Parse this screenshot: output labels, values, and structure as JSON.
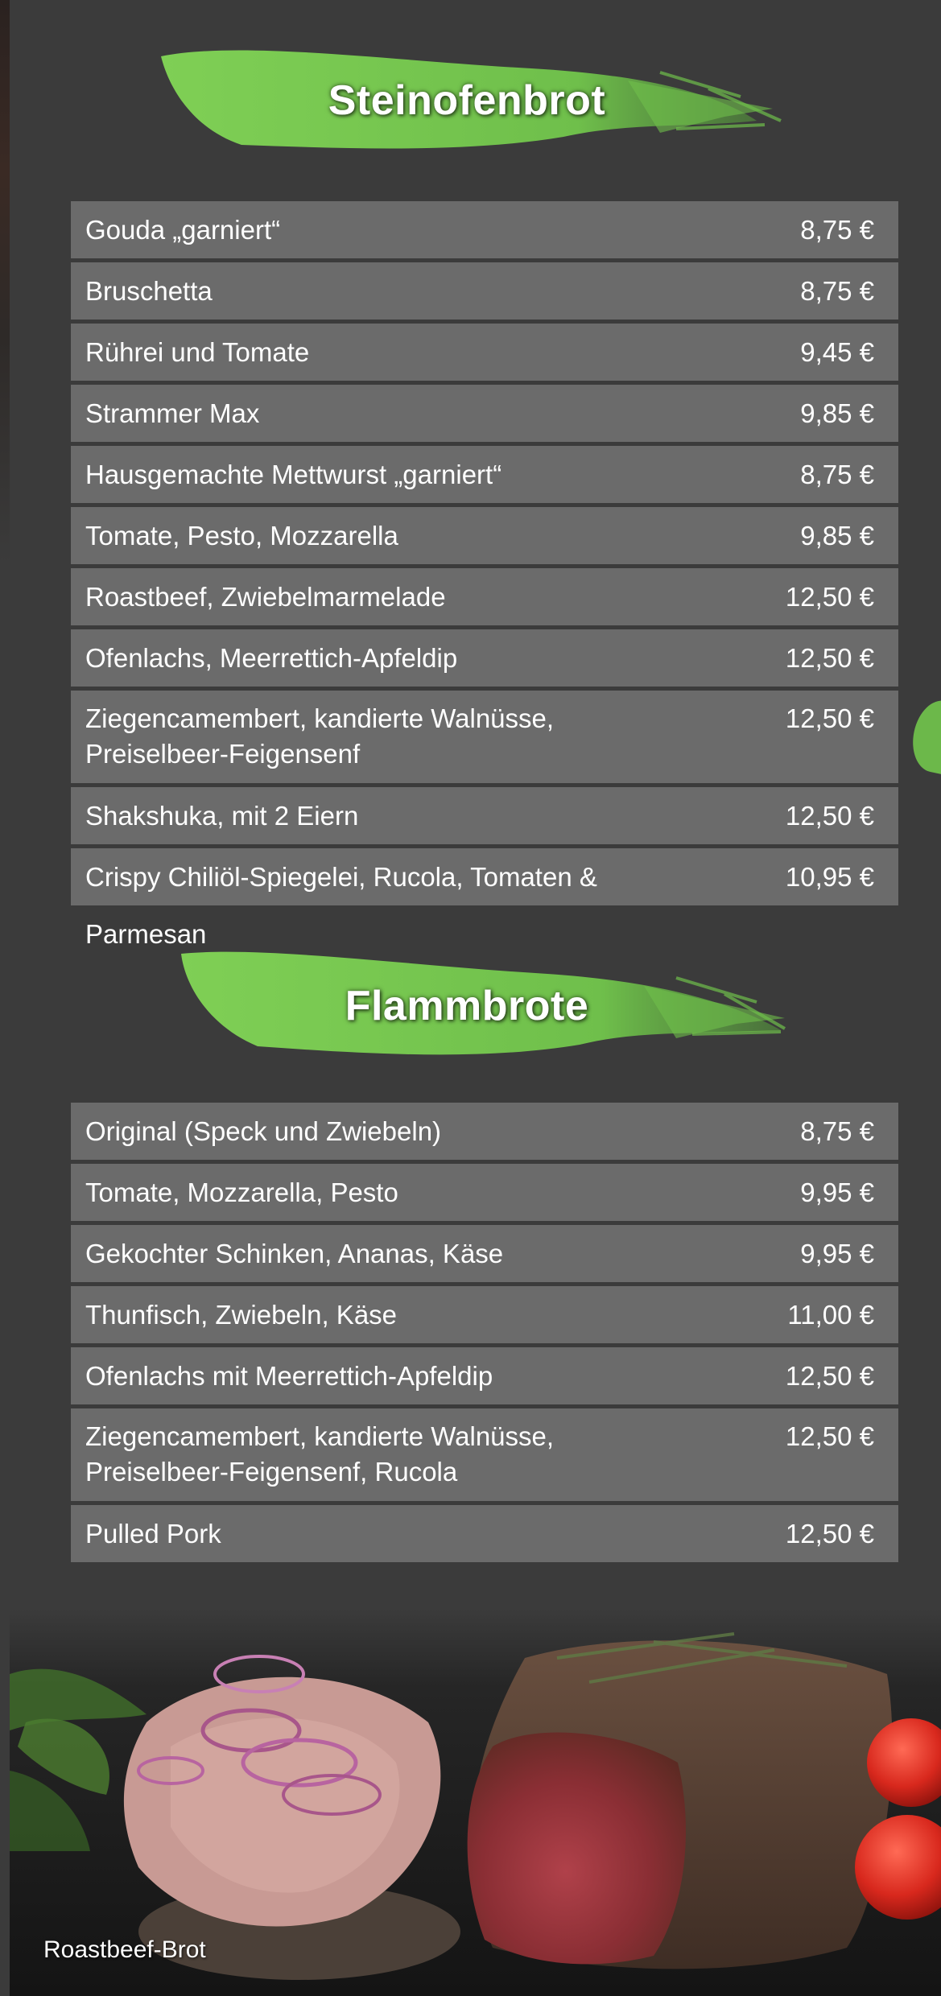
{
  "sections": [
    {
      "title": "Steinofenbrot",
      "items": [
        {
          "name": "Gouda  „garniert“",
          "price": "8,75 €"
        },
        {
          "name": "Bruschetta",
          "price": "8,75 €"
        },
        {
          "name": "Rührei und Tomate",
          "price": "9,45 €"
        },
        {
          "name": "Strammer Max",
          "price": "9,85 €"
        },
        {
          "name": "Hausgemachte Mettwurst  „garniert“",
          "price": "8,75 €"
        },
        {
          "name": "Tomate, Pesto, Mozzarella",
          "price": "9,85 €"
        },
        {
          "name": "Roastbeef, Zwiebelmarmelade",
          "price": "12,50 €"
        },
        {
          "name": "Ofenlachs, Meerrettich-Apfeldip",
          "price": "12,50 €"
        },
        {
          "name_line1": "Ziegencamembert, kandierte Walnüsse,",
          "name_line2": "Preiselbeer-Feigensenf",
          "price": "12,50 €"
        },
        {
          "name": "Shakshuka, mit 2 Eiern",
          "price": "12,50 €"
        },
        {
          "name": "Crispy Chiliöl-Spiegelei, Rucola, Tomaten & Parmesan",
          "price": "10,95 €"
        }
      ]
    },
    {
      "title": "Flammbrote",
      "items": [
        {
          "name": "Original (Speck und Zwiebeln)",
          "price": "8,75 €"
        },
        {
          "name": "Tomate, Mozzarella, Pesto",
          "price": "9,95 €"
        },
        {
          "name": "Gekochter Schinken, Ananas, Käse",
          "price": "9,95 €"
        },
        {
          "name": "Thunfisch, Zwiebeln, Käse",
          "price": "11,00 €"
        },
        {
          "name": "Ofenlachs mit Meerrettich-Apfeldip",
          "price": "12,50 €"
        },
        {
          "name_line1": "Ziegencamembert, kandierte Walnüsse,",
          "name_line2": "Preiselbeer-Feigensenf, Rucola",
          "price": "12,50 €"
        },
        {
          "name": "Pulled Pork",
          "price": "12,50 €"
        }
      ]
    }
  ],
  "photo_caption": "Roastbeef-Brot",
  "colors": {
    "background": "#3b3b3b",
    "row_background": "#6b6b6b",
    "accent_green": "#6fbf4b",
    "text": "#ffffff"
  }
}
